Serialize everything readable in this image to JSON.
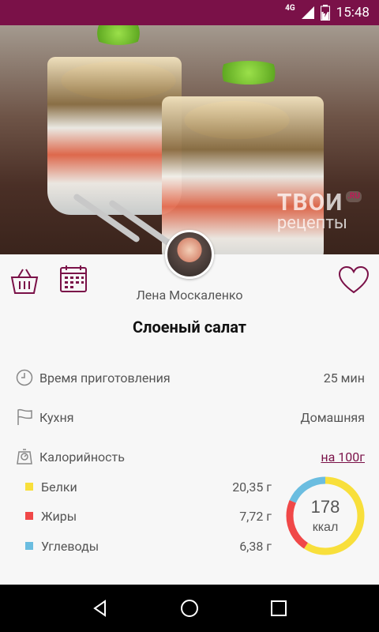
{
  "status": {
    "network": "4G",
    "time": "15:48"
  },
  "hero": {
    "watermark_big": "ТВОИ",
    "watermark_small": "рецепты",
    "watermark_ru": ".RU"
  },
  "author": {
    "name": "Лена Москаленко"
  },
  "recipe": {
    "title": "Слоеный салат"
  },
  "info": [
    {
      "icon": "clock-icon",
      "label": "Время приготовления",
      "value": "25 мин"
    },
    {
      "icon": "flag-icon",
      "label": "Кухня",
      "value": "Домашняя"
    },
    {
      "icon": "scale-icon",
      "label": "Калорийность",
      "value": "на 100г"
    }
  ],
  "nutrition": [
    {
      "name": "Белки",
      "value": "20,35 г",
      "color": "#f8df3b"
    },
    {
      "name": "Жиры",
      "value": "7,72 г",
      "color": "#f04848"
    },
    {
      "name": "Углеводы",
      "value": "6,38 г",
      "color": "#6bbde0"
    }
  ],
  "calories": {
    "value": "178",
    "unit": "ккал"
  },
  "colors": {
    "accent": "#7a1148"
  },
  "icons": {
    "basket": "basket-icon",
    "calendar": "calendar-icon",
    "favorite": "heart-icon"
  }
}
